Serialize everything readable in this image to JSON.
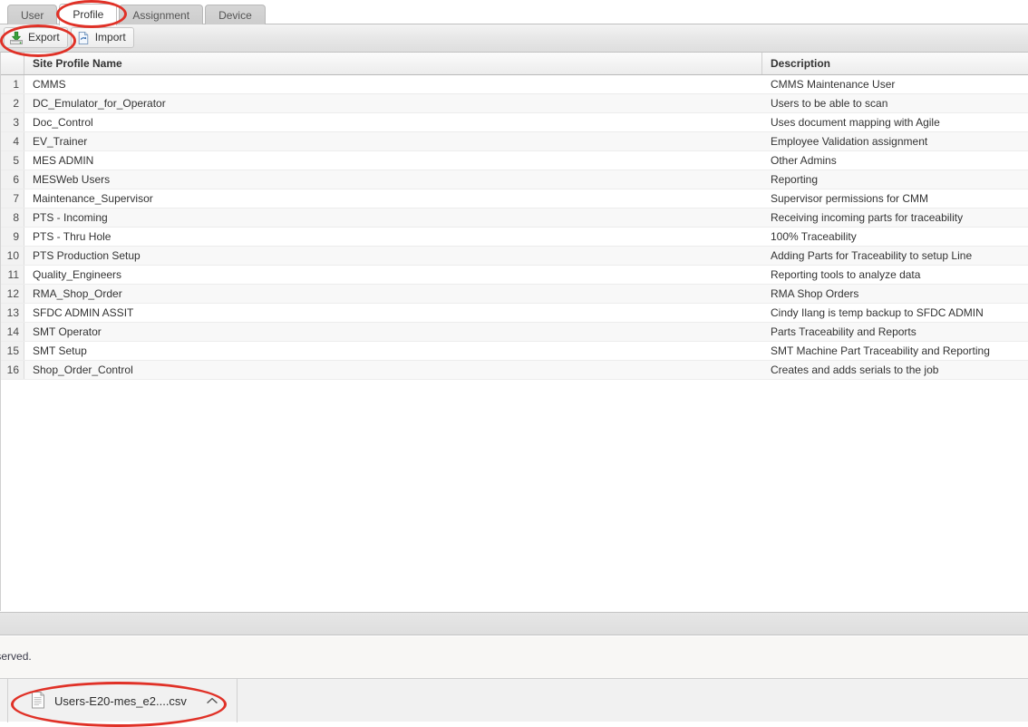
{
  "tabs": [
    {
      "label": "User",
      "active": false
    },
    {
      "label": "Profile",
      "active": true
    },
    {
      "label": "Assignment",
      "active": false
    },
    {
      "label": "Device",
      "active": false
    }
  ],
  "toolbar": {
    "export_label": "Export",
    "import_label": "Import",
    "export_icon": "export-download-icon",
    "import_icon": "import-page-icon"
  },
  "grid": {
    "columns": [
      "",
      "Site Profile Name",
      "Description"
    ],
    "rows": [
      {
        "n": "1",
        "name": "CMMS",
        "desc": "CMMS Maintenance User"
      },
      {
        "n": "2",
        "name": "DC_Emulator_for_Operator",
        "desc": "Users to be able to scan"
      },
      {
        "n": "3",
        "name": "Doc_Control",
        "desc": "Uses document mapping with Agile"
      },
      {
        "n": "4",
        "name": "EV_Trainer",
        "desc": "Employee Validation assignment"
      },
      {
        "n": "5",
        "name": "MES ADMIN",
        "desc": "Other Admins"
      },
      {
        "n": "6",
        "name": "MESWeb Users",
        "desc": "Reporting"
      },
      {
        "n": "7",
        "name": "Maintenance_Supervisor",
        "desc": "Supervisor permissions for CMM"
      },
      {
        "n": "8",
        "name": "PTS - Incoming",
        "desc": "Receiving incoming parts for traceability"
      },
      {
        "n": "9",
        "name": "PTS - Thru Hole",
        "desc": "100% Traceability"
      },
      {
        "n": "10",
        "name": "PTS Production Setup",
        "desc": "Adding Parts for Traceability to setup Line"
      },
      {
        "n": "11",
        "name": "Quality_Engineers",
        "desc": "Reporting tools to analyze data"
      },
      {
        "n": "12",
        "name": "RMA_Shop_Order",
        "desc": "RMA Shop Orders"
      },
      {
        "n": "13",
        "name": "SFDC ADMIN ASSIT",
        "desc": "Cindy Ilang is temp backup to SFDC ADMIN"
      },
      {
        "n": "14",
        "name": "SMT Operator",
        "desc": "Parts Traceability and Reports"
      },
      {
        "n": "15",
        "name": "SMT Setup",
        "desc": "SMT Machine Part Traceability and Reporting"
      },
      {
        "n": "16",
        "name": "Shop_Order_Control",
        "desc": "Creates and adds serials to the job"
      }
    ]
  },
  "footer": {
    "copyright": "ights reserved."
  },
  "download": {
    "filename": "Users-E20-mes_e2....csv",
    "file_icon": "document-file-icon",
    "chevron_icon": "chevron-up-icon"
  },
  "annotations": {
    "color": "#e03127",
    "targets": [
      "profile-tab",
      "export-button",
      "download-item"
    ]
  }
}
